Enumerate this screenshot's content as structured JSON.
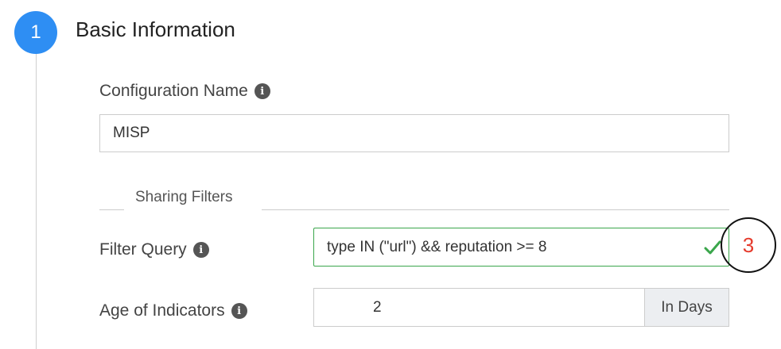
{
  "step": {
    "number": "1",
    "title": "Basic Information"
  },
  "config_name": {
    "label": "Configuration Name",
    "value": "MISP"
  },
  "sharing_filters": {
    "section_label": "Sharing Filters"
  },
  "filter_query": {
    "label": "Filter Query",
    "value": "type IN (\"url\") && reputation >= 8",
    "status": "valid"
  },
  "age_of_indicators": {
    "label": "Age of Indicators",
    "value": "2",
    "unit": "In Days"
  },
  "annotation": {
    "number": "3"
  },
  "colors": {
    "accent": "#2e8ef3",
    "valid": "#3aa64b",
    "annotation": "#e53b2c"
  },
  "icons": {
    "info": "info-icon",
    "check": "checkmark-icon"
  }
}
